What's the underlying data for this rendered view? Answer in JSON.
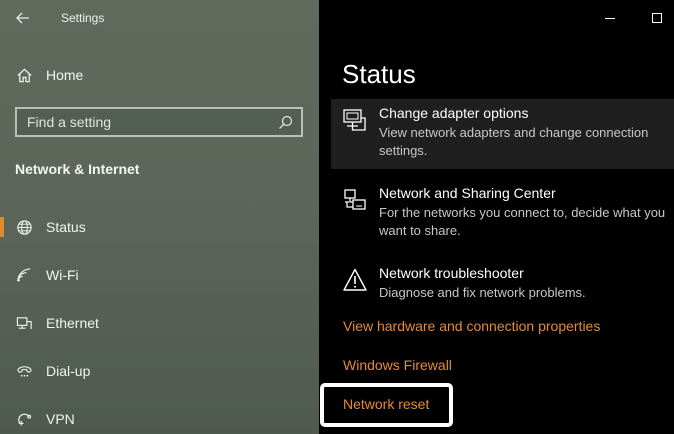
{
  "window": {
    "title": "Settings",
    "back_icon": "back-arrow-icon",
    "controls": [
      "minimize-icon",
      "maximize-icon"
    ]
  },
  "sidebar": {
    "home": {
      "label": "Home",
      "icon": "home-icon"
    },
    "search": {
      "placeholder": "Find a setting",
      "value": "",
      "icon": "search-icon"
    },
    "section_heading": "Network & Internet",
    "items": [
      {
        "label": "Status",
        "icon": "globe-icon",
        "active": true
      },
      {
        "label": "Wi-Fi",
        "icon": "wifi-icon",
        "active": false
      },
      {
        "label": "Ethernet",
        "icon": "ethernet-icon",
        "active": false
      },
      {
        "label": "Dial-up",
        "icon": "dialup-icon",
        "active": false
      },
      {
        "label": "VPN",
        "icon": "vpn-icon",
        "active": false
      }
    ],
    "accent_color": "#e08a2f"
  },
  "main": {
    "title": "Status",
    "entries": [
      {
        "title": "Change adapter options",
        "description": "View network adapters and change connection settings.",
        "icon": "network-adapter-icon"
      },
      {
        "title": "Network and Sharing Center",
        "description": "For the networks you connect to, decide what you want to share.",
        "icon": "sharing-center-icon"
      },
      {
        "title": "Network troubleshooter",
        "description": "Diagnose and fix network problems.",
        "icon": "warning-icon"
      }
    ],
    "links": [
      "View hardware and connection properties",
      "Windows Firewall",
      "Network reset"
    ],
    "link_color": "#e68a34"
  }
}
